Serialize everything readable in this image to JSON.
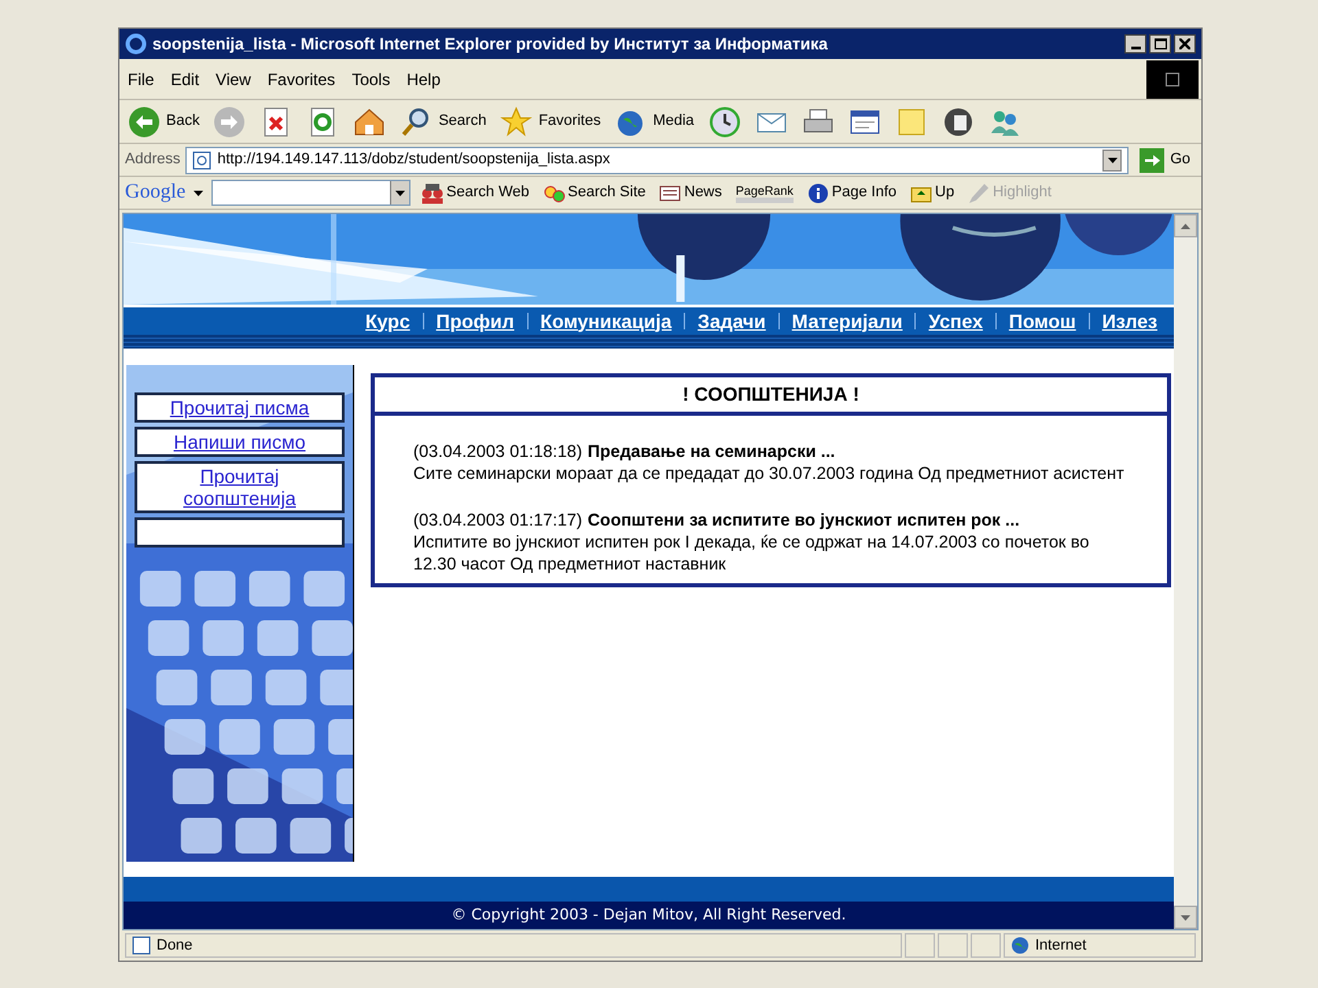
{
  "window": {
    "title": "soopstenija_lista - Microsoft Internet Explorer provided by Институт за Информатика"
  },
  "menu": [
    "File",
    "Edit",
    "View",
    "Favorites",
    "Tools",
    "Help"
  ],
  "toolbar": [
    {
      "kind": "back",
      "label": "Back"
    },
    {
      "kind": "forward"
    },
    {
      "kind": "stop"
    },
    {
      "kind": "refresh"
    },
    {
      "kind": "home"
    },
    {
      "kind": "search",
      "label": "Search"
    },
    {
      "kind": "favorites",
      "label": "Favorites"
    },
    {
      "kind": "media",
      "label": "Media"
    },
    {
      "kind": "history"
    },
    {
      "kind": "mail"
    },
    {
      "kind": "print"
    },
    {
      "kind": "edit"
    },
    {
      "kind": "note"
    },
    {
      "kind": "messenger"
    },
    {
      "kind": "people"
    }
  ],
  "address": {
    "label": "Address",
    "url": "http://194.149.147.113/dobz/student/soopstenija_lista.aspx",
    "go": "Go"
  },
  "google_bar": {
    "logo": "Google",
    "items": [
      {
        "kind": "search-web",
        "label": "Search Web"
      },
      {
        "kind": "search-site",
        "label": "Search Site"
      },
      {
        "kind": "news",
        "label": "News"
      },
      {
        "kind": "pagerank",
        "label": "PageRank"
      },
      {
        "kind": "info",
        "label": "Page Info"
      },
      {
        "kind": "up",
        "label": "Up"
      },
      {
        "kind": "highlight",
        "label": "Highlight",
        "disabled": true
      }
    ]
  },
  "page": {
    "nav": [
      "Курс",
      "Профил",
      "Комуникација",
      "Задачи",
      "Материјали",
      "Успех",
      "Помош",
      "Излез"
    ],
    "side_links": [
      "Прочитај писма",
      "Напиши писмо",
      "Прочитај соопштенија"
    ],
    "heading": "! СООПШТЕНИЈА !",
    "announcements": [
      {
        "date": "(03.04.2003 01:18:18)",
        "title": "Предавање на семинарски ...",
        "body": "Сите семинарски мораат да се предадат до 30.07.2003 година Од предметниот асистент"
      },
      {
        "date": "(03.04.2003 01:17:17)",
        "title": "Соопштени за испитите во јунскиот испитен рок ...",
        "body": "Испитите во јунскиот испитен рок I декада, ќе се одржат на 14.07.2003 со почеток во 12.30 часот Од предметниот наставник"
      }
    ],
    "footer": "© Copyright 2003 - Dejan Mitov, All Right Reserved."
  },
  "status_bar": {
    "text": "Done",
    "zone": "Internet"
  }
}
